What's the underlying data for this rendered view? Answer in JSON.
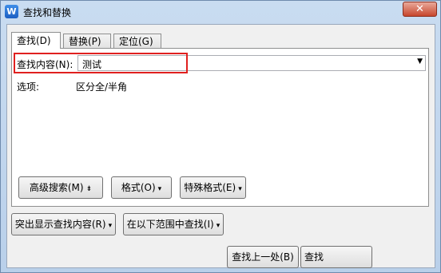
{
  "window": {
    "title": "查找和替换",
    "close_label": "✕",
    "app_icon_glyph": "W"
  },
  "tabs": [
    {
      "label": "查找(D)"
    },
    {
      "label": "替换(P)"
    },
    {
      "label": "定位(G)"
    }
  ],
  "find": {
    "label": "查找内容(N):",
    "value": "测试",
    "dropdown_glyph": "▼"
  },
  "options": {
    "label": "选项:",
    "value": "区分全/半角"
  },
  "panel_buttons": {
    "advanced": "高级搜索(M)",
    "advanced_glyph": "⇟",
    "format": "格式(O)",
    "special": "特殊格式(E)"
  },
  "bottom_buttons": {
    "highlight": "突出显示查找内容(R)",
    "find_in": "在以下范围中查找(I)",
    "find_prev": "查找上一处(B)",
    "find_next": "查找"
  },
  "dropdown_glyph": "▾",
  "colors": {
    "highlight_box": "#e0201f",
    "title_bg": "#c9dcf1",
    "close_bg": "#c7462d"
  }
}
